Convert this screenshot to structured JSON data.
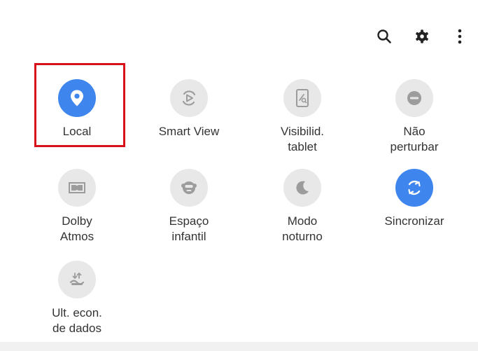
{
  "topbar": {
    "icons": [
      "search-icon",
      "gear-icon",
      "more-vert-icon"
    ]
  },
  "tiles": [
    {
      "label": "Local",
      "icon": "location-pin-icon",
      "active": true
    },
    {
      "label": "Smart View",
      "icon": "smart-view-icon",
      "active": false
    },
    {
      "label": "Visibilid.\ntablet",
      "icon": "tablet-visibility-icon",
      "active": false
    },
    {
      "label": "Não\nperturbar",
      "icon": "do-not-disturb-icon",
      "active": false
    },
    {
      "label": "Dolby\nAtmos",
      "icon": "dolby-atmos-icon",
      "active": false
    },
    {
      "label": "Espaço\ninfantil",
      "icon": "kids-space-icon",
      "active": false
    },
    {
      "label": "Modo\nnoturno",
      "icon": "night-mode-icon",
      "active": false
    },
    {
      "label": "Sincronizar",
      "icon": "sync-icon",
      "active": true
    },
    {
      "label": "Ult. econ.\nde dados",
      "icon": "data-saver-icon",
      "active": false
    }
  ],
  "colors": {
    "active_circle": "#3e86ee",
    "inactive_circle": "#e8e8e8",
    "highlight_border": "#d8121b"
  }
}
